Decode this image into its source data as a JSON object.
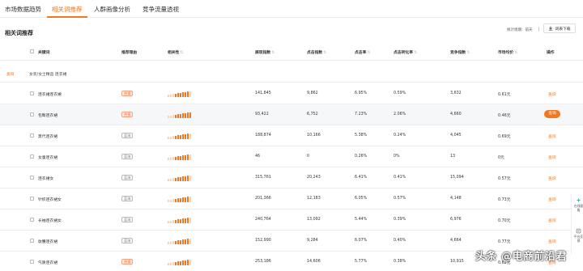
{
  "tabs": [
    {
      "label": "市场数据趋势"
    },
    {
      "label": "相关词推荐"
    },
    {
      "label": "人群画像分析"
    },
    {
      "label": "竞争流量透视"
    }
  ],
  "section": {
    "title": "相关词推荐",
    "period": "统计周期：前天",
    "download": "词表下载"
  },
  "table": {
    "headers": {
      "keyword": "关键词",
      "reason": "推荐理由",
      "relevance": "相关性",
      "exposure": "展现指数",
      "clicks": "点击指数",
      "ctr": "点击率",
      "cvr": "点击转化率",
      "competition": "竞争指数",
      "price": "市场均价",
      "action": "操作"
    },
    "sort_icon": "⇅",
    "category": {
      "label": "类目",
      "path": "女装/女士精品 连衣裙"
    },
    "rows": [
      {
        "keyword": "连衣裙连衣裙",
        "reason": "热搜",
        "reason_type": "hot",
        "relevance": 0.85,
        "exposure": "141,845",
        "clicks": "9,862",
        "ctr": "6.95%",
        "cvr": "0.59%",
        "competition": "3,632",
        "price": "0.61元",
        "action": "查询"
      },
      {
        "keyword": "包臀连衣裙",
        "reason": "热搜",
        "reason_type": "hot",
        "relevance": 1.0,
        "exposure": "93,422",
        "clicks": "6,752",
        "ctr": "7.23%",
        "cvr": "2.06%",
        "competition": "4,660",
        "price": "0.46元",
        "action": "查询"
      },
      {
        "keyword": "莫代连衣裙",
        "reason": "蓝海",
        "reason_type": "pot",
        "relevance": 0.85,
        "exposure": "188,874",
        "clicks": "10,166",
        "ctr": "5.38%",
        "cvr": "0.24%",
        "competition": "4,045",
        "price": "0.69元",
        "action": "查询"
      },
      {
        "keyword": "女童连衣裙",
        "reason": "蓝海",
        "reason_type": "pot",
        "relevance": 0.85,
        "exposure": "46",
        "clicks": "0",
        "ctr": "0.26%",
        "cvr": "0%",
        "competition": "13",
        "price": "0元",
        "action": "查询"
      },
      {
        "keyword": "连衣裙女",
        "reason": "蓝海",
        "reason_type": "pot",
        "relevance": 0.85,
        "exposure": "315,761",
        "clicks": "20,243",
        "ctr": "6.41%",
        "cvr": "0.41%",
        "competition": "15,094",
        "price": "0.57元",
        "action": "查询"
      },
      {
        "keyword": "针织连衣裙女",
        "reason": "蓝海",
        "reason_type": "pot",
        "relevance": 0.85,
        "exposure": "201,366",
        "clicks": "12,183",
        "ctr": "6.05%",
        "cvr": "0.57%",
        "competition": "4,148",
        "price": "0.73元",
        "action": "查询"
      },
      {
        "keyword": "长袖连衣裙女",
        "reason": "蓝海",
        "reason_type": "pot",
        "relevance": 0.85,
        "exposure": "240,764",
        "clicks": "13,092",
        "ctr": "5.44%",
        "cvr": "0.39%",
        "competition": "6,976",
        "price": "0.70元",
        "action": "查询"
      },
      {
        "keyword": "收腰连衣裙",
        "reason": "蓝海",
        "reason_type": "pot",
        "relevance": 0.85,
        "exposure": "152,990",
        "clicks": "9,284",
        "ctr": "6.07%",
        "cvr": "0.40%",
        "competition": "4,664",
        "price": "0.77元",
        "action": "查询"
      },
      {
        "keyword": "气质连衣裙",
        "reason": "热搜",
        "reason_type": "hot",
        "relevance": 0.85,
        "exposure": "253,186",
        "clicks": "14,606",
        "ctr": "5.77%",
        "cvr": "0.38%",
        "competition": "10,915",
        "price": "0.62元",
        "action": "查询"
      }
    ]
  },
  "side_panel": {
    "items": [
      {
        "label": "在线客服",
        "icon": "customer-service-icon"
      },
      {
        "label": "平台反馈",
        "icon": "feedback-icon"
      }
    ]
  },
  "watermark": "头条 @电商前沿君",
  "colors": {
    "accent": "#f4771f",
    "hot_badge": "#f15a24",
    "bar_dark": "#f4771f",
    "bar_light": "#fbd2b3"
  }
}
